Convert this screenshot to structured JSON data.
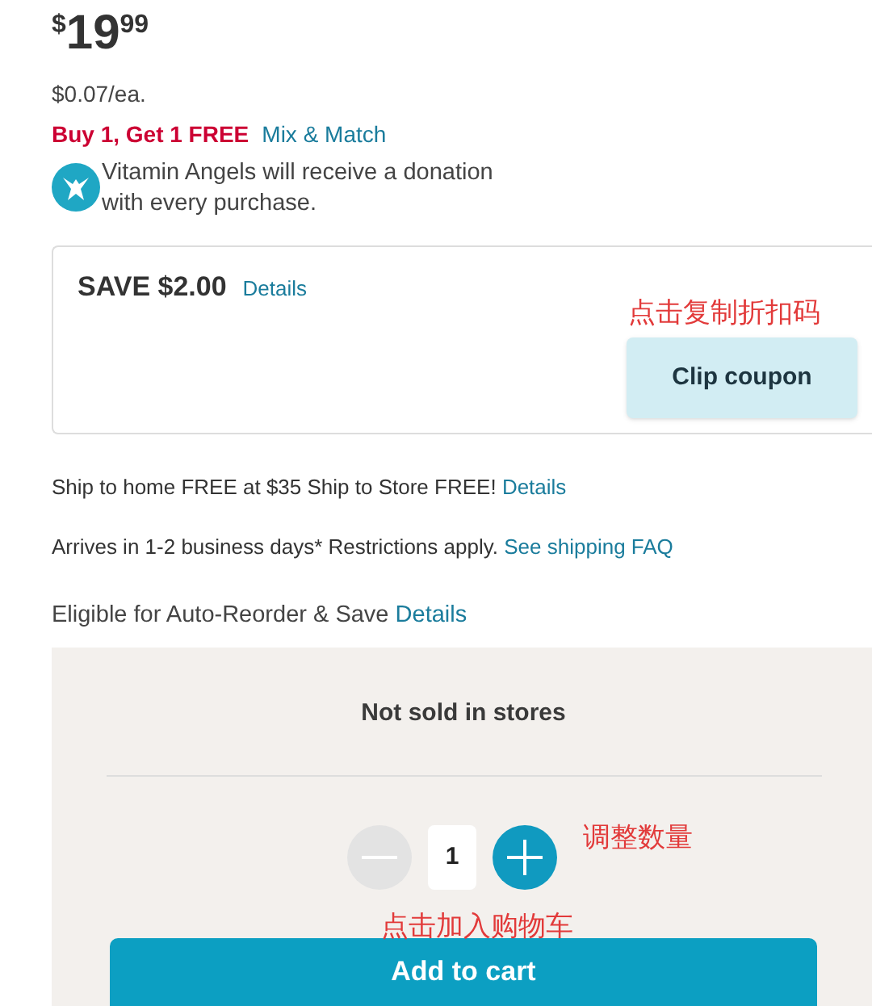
{
  "price": {
    "currency": "$",
    "whole": "19",
    "cents": "99"
  },
  "unit_price": "$0.07/ea.",
  "promo": {
    "offer": "Buy 1, Get 1 FREE",
    "link": "Mix & Match"
  },
  "donation": "Vitamin Angels will receive a donation with every purchase.",
  "coupon": {
    "title": "SAVE $2.00",
    "details": "Details",
    "button": "Clip coupon",
    "annotation": "点击复制折扣码"
  },
  "shipping": [
    {
      "text": "Ship to home FREE at $35 Ship to Store FREE!",
      "link": "Details"
    },
    {
      "text": "Arrives in 1-2 business days* Restrictions apply.",
      "link": "See shipping FAQ"
    }
  ],
  "auto_reorder": {
    "text": "Eligible for Auto-Reorder & Save",
    "link": "Details"
  },
  "purchase_panel": {
    "availability": "Not sold in stores",
    "quantity": "1",
    "decrease_disabled": true,
    "quantity_annotation": "调整数量",
    "cart_annotation": "点击加入购物车",
    "add_button": "Add to cart"
  }
}
